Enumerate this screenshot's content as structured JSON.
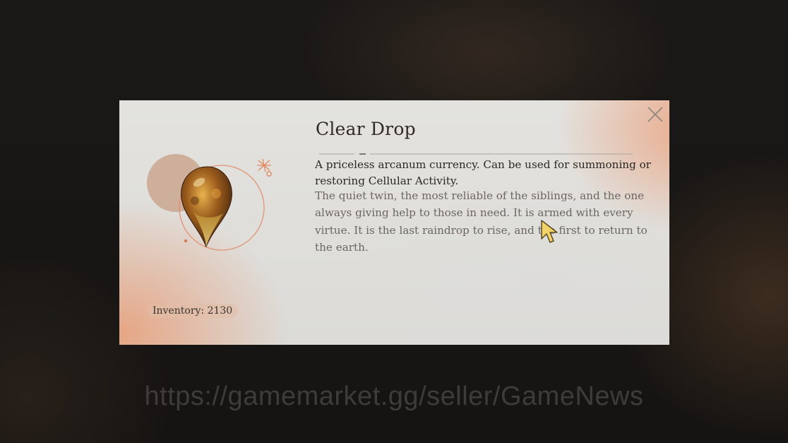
{
  "item": {
    "name": "Clear Drop",
    "summary": "A priceless arcanum currency. Can be used for summoning or restoring Cellular Activity.",
    "lore": "The quiet twin, the most reliable of the siblings, and the one always giving help to those in need. It is armed with every virtue. It is the last raindrop to rise, and the first to return to the earth.",
    "inventory_label": "Inventory: 2130",
    "icon": "amber-drop-icon"
  },
  "dialog": {
    "close_icon": "close-icon"
  },
  "watermark": {
    "text": "https://gamemarket.gg/seller/GameNews"
  },
  "colors": {
    "accent": "#e39a78",
    "panel": "#e0dfdb",
    "drop_amber": "#b8822a"
  }
}
